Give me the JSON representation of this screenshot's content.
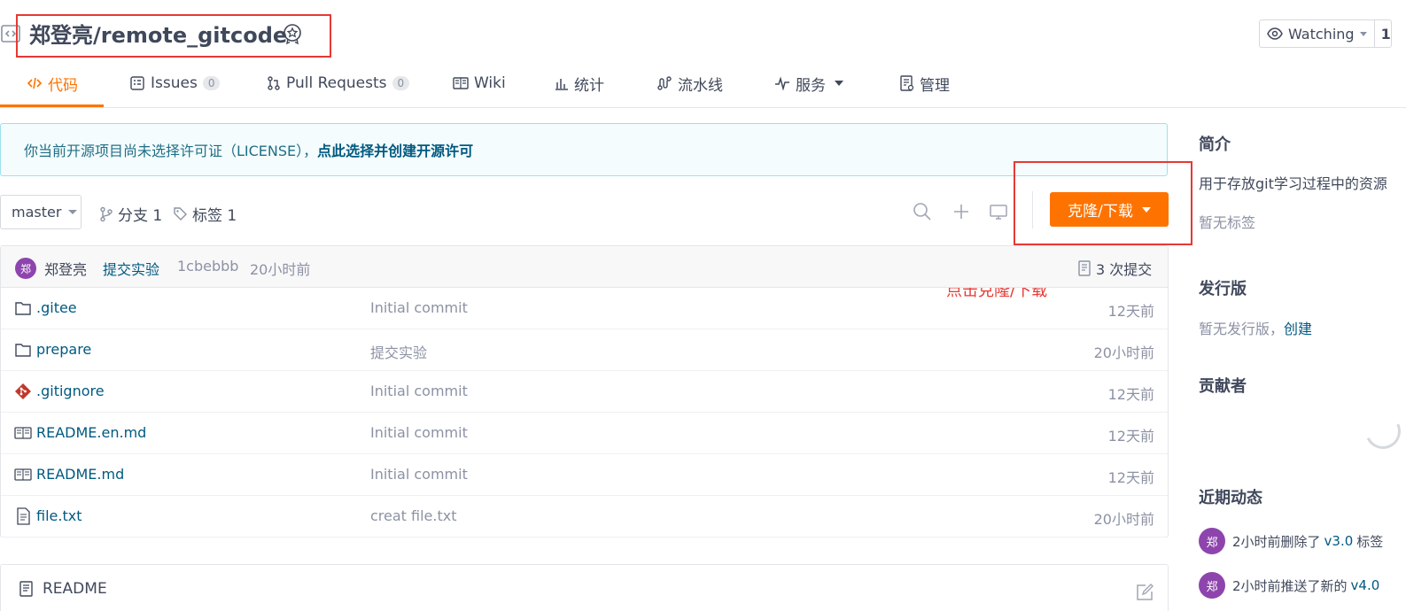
{
  "header": {
    "repo_title": "郑登亮/remote_gitcode",
    "watch_label": "Watching",
    "watch_count": "1"
  },
  "tabs": [
    {
      "label": "代码",
      "icon": "code-icon"
    },
    {
      "label": "Issues",
      "count": "0",
      "icon": "issues-icon"
    },
    {
      "label": "Pull Requests",
      "count": "0",
      "icon": "pull-request-icon"
    },
    {
      "label": "Wiki",
      "icon": "wiki-icon"
    },
    {
      "label": "统计",
      "icon": "chart-icon"
    },
    {
      "label": "流水线",
      "icon": "pipeline-icon"
    },
    {
      "label": "服务",
      "icon": "pulse-icon"
    },
    {
      "label": "管理",
      "icon": "manage-icon"
    }
  ],
  "license_notice": {
    "text": "你当前开源项目尚未选择许可证（LICENSE），",
    "link": "点此选择并创建开源许可"
  },
  "toolbar": {
    "branch": "master",
    "branches_label": "分支 1",
    "tags_label": "标签 1",
    "clone_label": "克隆/下载"
  },
  "annotation": "点击克隆/下载",
  "commit": {
    "avatar": "郑",
    "author": "郑登亮",
    "message": "提交实验",
    "sha": "1cbebbb",
    "time": "20小时前",
    "count": "3 次提交"
  },
  "files": [
    {
      "name": ".gitee",
      "type": "folder-icon",
      "message": "Initial commit",
      "time": "12天前"
    },
    {
      "name": "prepare",
      "type": "folder-icon",
      "message": "提交实验",
      "time": "20小时前"
    },
    {
      "name": ".gitignore",
      "type": "git-icon",
      "message": "Initial commit",
      "time": "12天前"
    },
    {
      "name": "README.en.md",
      "type": "book-icon",
      "message": "Initial commit",
      "time": "12天前"
    },
    {
      "name": "README.md",
      "type": "book-icon",
      "message": "Initial commit",
      "time": "12天前"
    },
    {
      "name": "file.txt",
      "type": "file-icon",
      "message": "creat file.txt",
      "time": "20小时前"
    }
  ],
  "readme": {
    "title": "README"
  },
  "sidebar": {
    "intro_heading": "简介",
    "intro_text": "用于存放git学习过程中的资源",
    "no_tags": "暂无标签",
    "release_heading": "发行版",
    "no_release": "暂无发行版，",
    "create_link": "创建",
    "contributors_heading": "贡献者",
    "activity_heading": "近期动态",
    "activities": [
      {
        "avatar": "郑",
        "text": "2小时前删除了",
        "link": "v3.0",
        "suffix": "标签"
      },
      {
        "avatar": "郑",
        "text": "2小时前推送了新的",
        "link": "v4.0",
        "suffix": ""
      }
    ]
  },
  "colors": {
    "accent": "#fe7300",
    "link": "#005980",
    "annotation": "#e53935"
  }
}
